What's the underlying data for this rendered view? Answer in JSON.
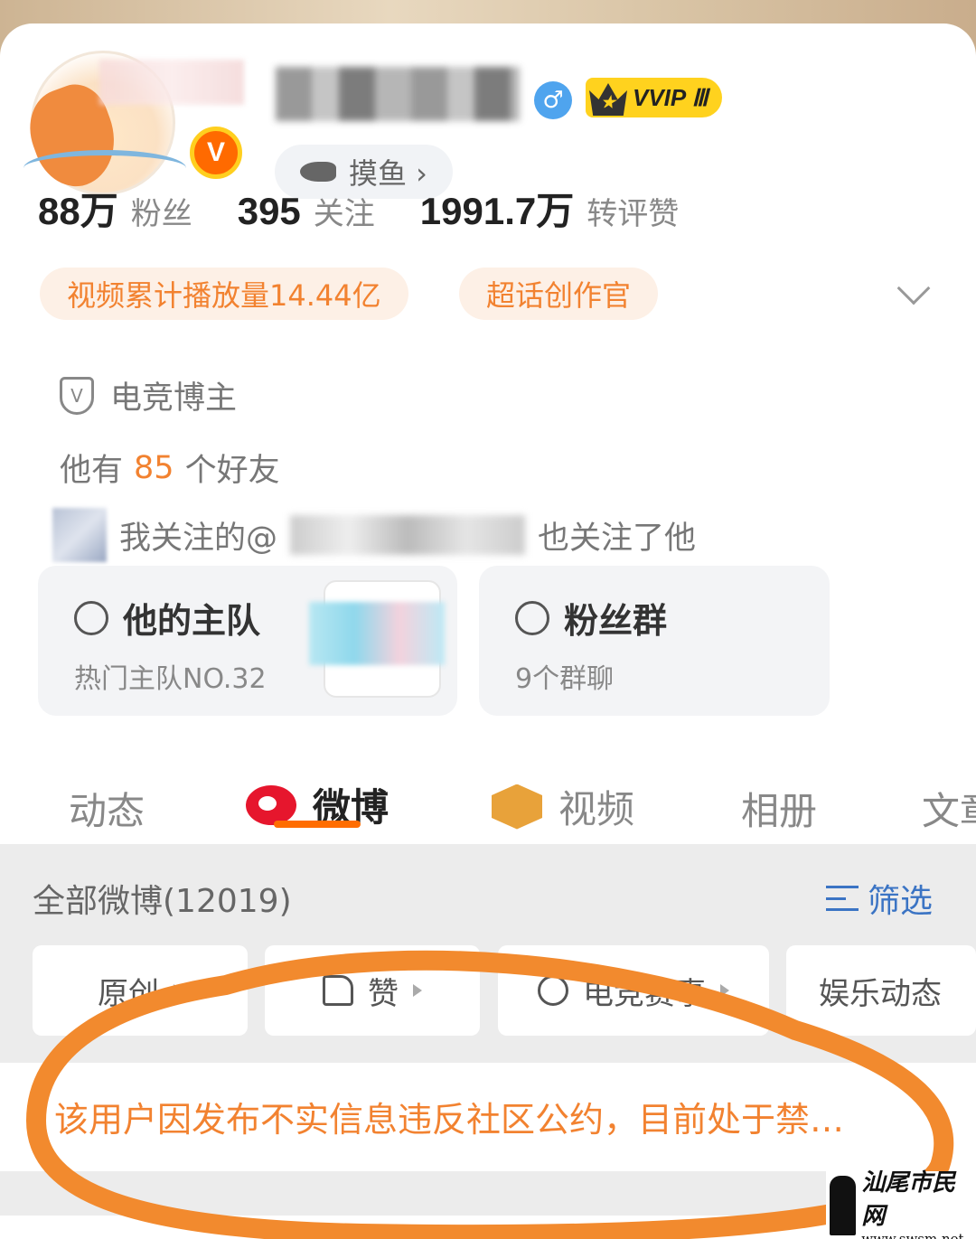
{
  "profile": {
    "gender_symbol": "♂",
    "vip_label": "VVIP Ⅲ",
    "verified_mark": "V",
    "tag": "摸鱼 ›"
  },
  "stats": [
    {
      "num": "88万",
      "label": "粉丝"
    },
    {
      "num": "395",
      "label": "关注"
    },
    {
      "num": "1991.7万",
      "label": "转评赞"
    }
  ],
  "badges": {
    "video_plays": "视频累计播放量14.44亿",
    "super_topic": "超话创作官"
  },
  "info": {
    "shield_glyph": "V",
    "category": "电竞博主",
    "friends_prefix": "他有",
    "friends_count": "85",
    "friends_suffix": "个好友",
    "follow_prefix": "我关注的@",
    "follow_suffix": "也关注了他"
  },
  "cards": {
    "team_title": "他的主队",
    "team_sub": "热门主队NO.32",
    "fans_title": "粉丝群",
    "fans_sub": "9个群聊"
  },
  "tabs": [
    "动态",
    "微博",
    "视频",
    "相册",
    "文章"
  ],
  "active_tab": "微博",
  "feed": {
    "all_label": "全部微博(12019)",
    "filter_label": "筛选",
    "chips": [
      "原创",
      "赞",
      "电竞赛事",
      "娱乐动态"
    ]
  },
  "notice": "该用户因发布不实信息违反社区公约，目前处于禁…",
  "watermark": {
    "name": "汕尾市民网",
    "url": "www.swsm.net"
  },
  "colors": {
    "accent_orange": "#f28230",
    "tab_underline": "#ff6d00",
    "filter_blue": "#3b74c4",
    "annotation_oval": "#f28a2e"
  }
}
